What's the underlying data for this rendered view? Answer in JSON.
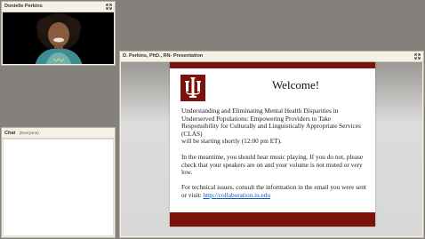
{
  "camera_pod": {
    "title": "Donielle Perkins"
  },
  "chat_pod": {
    "title": "Chat",
    "scope": "(Everyone)"
  },
  "presentation_pod": {
    "title": "D. Perkins, PhD., RN- Presentation",
    "slide": {
      "heading": "Welcome!",
      "topic": "Understanding and Eliminating Mental Health Disparities in Underserved Populations: Empowering Providers to Take Responsibility for Culturally and Linguistically Appropriate Services (CLAS)",
      "start_note": "will be starting shortly (12:00 pm ET).",
      "music_note": "In the meantime, you should hear music playing. If you do not, please check that your speakers are on and your volume is not muted or very low.",
      "tech_note": "For technical issues, consult the information in the email you were sent or visit:",
      "link": "http://collaboration.iu.edu"
    }
  },
  "colors": {
    "brand": "#7d110c",
    "link": "#1a56b8",
    "background": "#84817c"
  },
  "icons": {
    "expand": "expand-arrows-icon",
    "logo": "iu-trident-logo"
  }
}
